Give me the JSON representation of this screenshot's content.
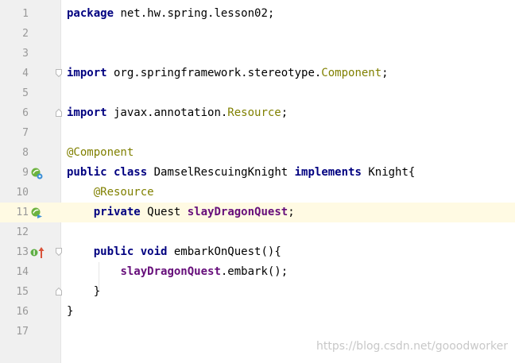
{
  "editor": {
    "lines": [
      {
        "n": "1",
        "t": [
          {
            "s": "package",
            "c": "kw"
          },
          {
            "s": " net.hw.spring.lesson02;",
            "c": ""
          }
        ]
      },
      {
        "n": "2",
        "t": []
      },
      {
        "n": "3",
        "t": []
      },
      {
        "n": "4",
        "t": [
          {
            "s": "import",
            "c": "kw"
          },
          {
            "s": " org.springframework.stereotype.",
            "c": ""
          },
          {
            "s": "Component",
            "c": "cls"
          },
          {
            "s": ";",
            "c": ""
          }
        ]
      },
      {
        "n": "5",
        "t": []
      },
      {
        "n": "6",
        "t": [
          {
            "s": "import",
            "c": "kw"
          },
          {
            "s": " javax.annotation.",
            "c": ""
          },
          {
            "s": "Resource",
            "c": "cls"
          },
          {
            "s": ";",
            "c": ""
          }
        ]
      },
      {
        "n": "7",
        "t": []
      },
      {
        "n": "8",
        "t": [
          {
            "s": "@Component",
            "c": "ann"
          }
        ]
      },
      {
        "n": "9",
        "t": [
          {
            "s": "public",
            "c": "kw"
          },
          {
            "s": " ",
            "c": ""
          },
          {
            "s": "class",
            "c": "kw"
          },
          {
            "s": " DamselRescuingKnight ",
            "c": ""
          },
          {
            "s": "implements",
            "c": "kw"
          },
          {
            "s": " Knight{",
            "c": ""
          }
        ]
      },
      {
        "n": "10",
        "t": [
          {
            "s": "    ",
            "c": ""
          },
          {
            "s": "@Resource",
            "c": "ann"
          }
        ]
      },
      {
        "n": "11",
        "t": [
          {
            "s": "    ",
            "c": ""
          },
          {
            "s": "private",
            "c": "kw"
          },
          {
            "s": " Quest ",
            "c": ""
          },
          {
            "s": "slayDragonQuest",
            "c": "fld"
          },
          {
            "s": ";",
            "c": ""
          }
        ]
      },
      {
        "n": "12",
        "t": []
      },
      {
        "n": "13",
        "t": [
          {
            "s": "    ",
            "c": ""
          },
          {
            "s": "public",
            "c": "kw"
          },
          {
            "s": " ",
            "c": ""
          },
          {
            "s": "void",
            "c": "kw"
          },
          {
            "s": " embarkOnQuest(){",
            "c": ""
          }
        ]
      },
      {
        "n": "14",
        "t": [
          {
            "s": "        ",
            "c": ""
          },
          {
            "s": "slayDragonQuest",
            "c": "fld"
          },
          {
            "s": ".embark();",
            "c": ""
          }
        ]
      },
      {
        "n": "15",
        "t": [
          {
            "s": "    }",
            "c": ""
          }
        ]
      },
      {
        "n": "16",
        "t": [
          {
            "s": "}",
            "c": ""
          }
        ]
      },
      {
        "n": "17",
        "t": []
      }
    ],
    "caret_line": "11"
  },
  "gutter_icons": {
    "line9": "spring-bean-icon",
    "line11": "spring-bean-autowired-icon",
    "line13_a": "implements-method-icon",
    "line13_b": "up-arrow-icon"
  },
  "colors": {
    "keyword": "#000080",
    "annotation": "#808000",
    "field": "#660e7a",
    "caret_row": "#fffae3",
    "gutter": "#f0f0f0"
  },
  "watermark": "https://blog.csdn.net/gooodworker"
}
